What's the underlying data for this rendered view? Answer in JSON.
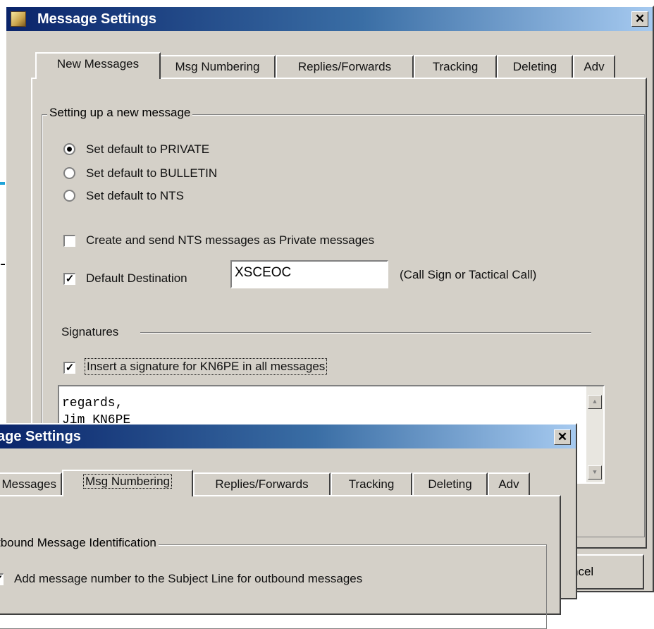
{
  "back_window": {
    "title": "Message Settings",
    "tabs": [
      "New Messages",
      "Msg Numbering",
      "Replies/Forwards",
      "Tracking",
      "Deleting",
      "Adv"
    ],
    "active_tab": "New Messages",
    "group_title": "Setting up a new message",
    "radios": [
      {
        "label": "Set default to PRIVATE",
        "checked": true
      },
      {
        "label": "Set default to BULLETIN",
        "checked": false
      },
      {
        "label": "Set default to NTS",
        "checked": false
      }
    ],
    "nts_private": {
      "label": "Create and send NTS messages as Private messages",
      "checked": false
    },
    "default_destination": {
      "label": "Default Destination",
      "checked": true,
      "value": "XSCEOC",
      "hint": "(Call Sign or Tactical Call)"
    },
    "signatures_title": "Signatures",
    "insert_signature": {
      "label": "Insert a signature for KN6PE in all messages",
      "checked": true
    },
    "signature_lines": [
      "regards,",
      "Jim  KN6PE"
    ],
    "cancel_label": "ncel"
  },
  "front_window": {
    "title": "age Settings",
    "tabs": [
      "Messages",
      "Msg Numbering",
      "Replies/Forwards",
      "Tracking",
      "Deleting",
      "Adv"
    ],
    "active_tab": "Msg Numbering",
    "group_title": "tbound Message Identification",
    "add_number": {
      "label": "Add message number to the Subject Line for outbound messages",
      "checked": true
    }
  },
  "icons": {
    "close": "close-icon",
    "app": "app-icon",
    "scroll_up": "scroll-up-icon",
    "scroll_down": "scroll-down-icon"
  },
  "colors": {
    "titlebar_start": "#0a246a",
    "titlebar_end": "#a6caf0",
    "dialog_face": "#d4d0c8",
    "annotation_line": "#1fa3d8"
  }
}
